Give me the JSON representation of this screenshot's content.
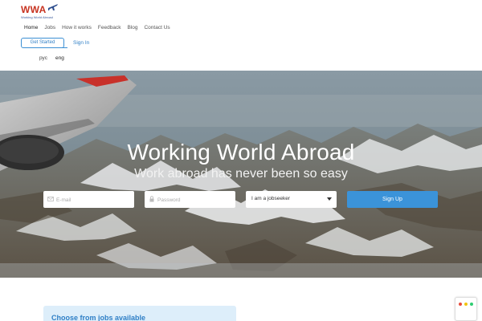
{
  "header": {
    "logo_text": "WWA",
    "logo_sub": "Working World Abroad",
    "nav": [
      "Home",
      "Jobs",
      "How it works",
      "Feedback",
      "Blog",
      "Contact Us"
    ],
    "get_started": "Get Started",
    "sign_in": "Sign In",
    "languages": [
      "рус",
      "eng"
    ]
  },
  "hero": {
    "title": "Working World Abroad",
    "subtitle": "Work abroad has never been so easy",
    "email_placeholder": "E-mail",
    "password_placeholder": "Password",
    "role_select": "I am a jobseeker",
    "signup": "Sign Up"
  },
  "section": {
    "card_title": "Choose from jobs available"
  },
  "colors": {
    "accent": "#3b93d9",
    "logo_red": "#c7321f"
  }
}
